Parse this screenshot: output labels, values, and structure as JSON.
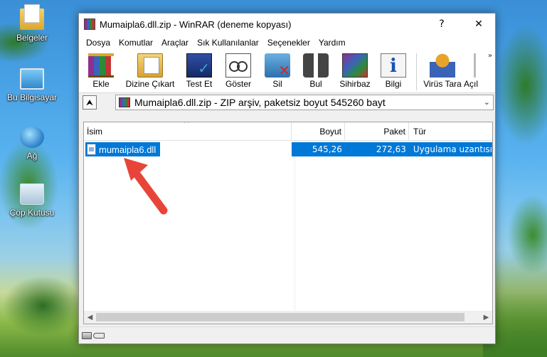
{
  "desktop": {
    "icons": [
      {
        "label": "Belgeler"
      },
      {
        "label": "Bu Bilgisayar"
      },
      {
        "label": "Ağ"
      },
      {
        "label": "Çöp Kutusu"
      }
    ]
  },
  "window": {
    "title": "Mumaipla6.dll.zip - WinRAR (deneme kopyası)",
    "help_button": "?",
    "close_button": "✕"
  },
  "menu": [
    {
      "label": "Dosya"
    },
    {
      "label": "Komutlar"
    },
    {
      "label": "Araçlar"
    },
    {
      "label": "Sık Kullanılanlar"
    },
    {
      "label": "Seçenekler"
    },
    {
      "label": "Yardım"
    }
  ],
  "toolbar": {
    "tools": [
      {
        "label": "Ekle",
        "icon": "add-archive-icon"
      },
      {
        "label": "Dizine Çıkart",
        "icon": "extract-folder-icon"
      },
      {
        "label": "Test Et",
        "icon": "test-icon"
      },
      {
        "label": "Göster",
        "icon": "view-icon"
      },
      {
        "label": "Sil",
        "icon": "delete-icon"
      },
      {
        "label": "Bul",
        "icon": "find-icon"
      },
      {
        "label": "Sihirbaz",
        "icon": "wizard-icon"
      },
      {
        "label": "Bilgi",
        "icon": "info-icon"
      },
      {
        "label": "Virüs Tara",
        "icon": "virus-scan-icon"
      },
      {
        "label": "Açıl",
        "icon": "open-icon"
      }
    ],
    "overflow": "»"
  },
  "pathbar": {
    "up_glyph": "⮝",
    "path": "Mumaipla6.dll.zip - ZIP arşiv, paketsiz boyut 545260 bayt",
    "dropdown_glyph": "⌄"
  },
  "list": {
    "columns": {
      "name": "İsim",
      "size": "Boyut",
      "packed": "Paket",
      "type": "Tür"
    },
    "sort_glyph": "^",
    "rows": [
      {
        "name": "mumaipla6.dll",
        "size": "545,26",
        "packed": "272,63",
        "type": "Uygulama uzantısı",
        "selected": true
      }
    ]
  },
  "scroll": {
    "left": "◀",
    "right": "▶"
  },
  "colors": {
    "selection": "#0078d7",
    "arrow": "#e8453a"
  }
}
